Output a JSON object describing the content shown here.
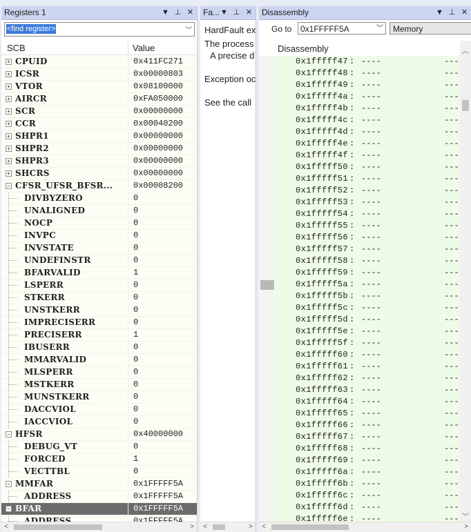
{
  "registers": {
    "title": "Registers 1",
    "find_placeholder": "<find register>",
    "col_name": "SCB",
    "col_value": "Value",
    "rows": [
      {
        "name": "CPUID",
        "value": "0x411FC271",
        "level": 0,
        "expander": "+"
      },
      {
        "name": "ICSR",
        "value": "0x00000803",
        "level": 0,
        "expander": "+"
      },
      {
        "name": "VTOR",
        "value": "0x08100000",
        "level": 0,
        "expander": "+"
      },
      {
        "name": "AIRCR",
        "value": "0xFA050000",
        "level": 0,
        "expander": "+"
      },
      {
        "name": "SCR",
        "value": "0x00000000",
        "level": 0,
        "expander": "+"
      },
      {
        "name": "CCR",
        "value": "0x00040200",
        "level": 0,
        "expander": "+"
      },
      {
        "name": "SHPR1",
        "value": "0x00000000",
        "level": 0,
        "expander": "+"
      },
      {
        "name": "SHPR2",
        "value": "0x00000000",
        "level": 0,
        "expander": "+"
      },
      {
        "name": "SHPR3",
        "value": "0x00000000",
        "level": 0,
        "expander": "+"
      },
      {
        "name": "SHCRS",
        "value": "0x00000000",
        "level": 0,
        "expander": "+"
      },
      {
        "name": "CFSR_UFSR_BFSR...",
        "value": "0x00008200",
        "level": 0,
        "expander": "−"
      },
      {
        "name": "DIVBYZERO",
        "value": "0",
        "level": 1
      },
      {
        "name": "UNALIGNED",
        "value": "0",
        "level": 1
      },
      {
        "name": "NOCP",
        "value": "0",
        "level": 1
      },
      {
        "name": "INVPC",
        "value": "0",
        "level": 1
      },
      {
        "name": "INVSTATE",
        "value": "0",
        "level": 1
      },
      {
        "name": "UNDEFINSTR",
        "value": "0",
        "level": 1
      },
      {
        "name": "BFARVALID",
        "value": "1",
        "level": 1
      },
      {
        "name": "LSPERR",
        "value": "0",
        "level": 1
      },
      {
        "name": "STKERR",
        "value": "0",
        "level": 1
      },
      {
        "name": "UNSTKERR",
        "value": "0",
        "level": 1
      },
      {
        "name": "IMPRECISERR",
        "value": "0",
        "level": 1
      },
      {
        "name": "PRECISERR",
        "value": "1",
        "level": 1
      },
      {
        "name": "IBUSERR",
        "value": "0",
        "level": 1
      },
      {
        "name": "MMARVALID",
        "value": "0",
        "level": 1
      },
      {
        "name": "MLSPERR",
        "value": "0",
        "level": 1
      },
      {
        "name": "MSTKERR",
        "value": "0",
        "level": 1
      },
      {
        "name": "MUNSTKERR",
        "value": "0",
        "level": 1
      },
      {
        "name": "DACCVIOL",
        "value": "0",
        "level": 1
      },
      {
        "name": "IACCVIOL",
        "value": "0",
        "level": 1
      },
      {
        "name": "HFSR",
        "value": "0x40000000",
        "level": 0,
        "expander": "−"
      },
      {
        "name": "DEBUG_VT",
        "value": "0",
        "level": 1
      },
      {
        "name": "FORCED",
        "value": "1",
        "level": 1
      },
      {
        "name": "VECTTBL",
        "value": "0",
        "level": 1
      },
      {
        "name": "MMFAR",
        "value": "0x1FFFFF5A",
        "level": 0,
        "expander": "−"
      },
      {
        "name": "ADDRESS",
        "value": "0x1FFFFF5A",
        "level": 1
      },
      {
        "name": "BFAR",
        "value": "0x1FFFFF5A",
        "level": 0,
        "expander": "−",
        "selected": true
      },
      {
        "name": "ADDRESS",
        "value": "0x1FFFFF5A",
        "level": 1
      }
    ]
  },
  "fault": {
    "title": "Fa...",
    "line1": "HardFault ex",
    "line2": "The process",
    "line3": "A precise d",
    "line4": "Exception oc",
    "line5": "See the call"
  },
  "disassembly": {
    "title": "Disassembly",
    "goto_label": "Go to",
    "goto_value": "0x1FFFFF5A",
    "memory_label": "Memory",
    "column_header": "Disassembly",
    "rows": [
      "0x1fffff47",
      "0x1fffff48",
      "0x1fffff49",
      "0x1fffff4a",
      "0x1fffff4b",
      "0x1fffff4c",
      "0x1fffff4d",
      "0x1fffff4e",
      "0x1fffff4f",
      "0x1fffff50",
      "0x1fffff51",
      "0x1fffff52",
      "0x1fffff53",
      "0x1fffff54",
      "0x1fffff55",
      "0x1fffff56",
      "0x1fffff57",
      "0x1fffff58",
      "0x1fffff59",
      "0x1fffff5a",
      "0x1fffff5b",
      "0x1fffff5c",
      "0x1fffff5d",
      "0x1fffff5e",
      "0x1fffff5f",
      "0x1fffff60",
      "0x1fffff61",
      "0x1fffff62",
      "0x1fffff63",
      "0x1fffff64",
      "0x1fffff65",
      "0x1fffff66",
      "0x1fffff67",
      "0x1fffff68",
      "0x1fffff69",
      "0x1fffff6a",
      "0x1fffff6b",
      "0x1fffff6c",
      "0x1fffff6d",
      "0x1fffff6e"
    ],
    "colon": ":",
    "opcode": "----",
    "mnemonic": "---"
  },
  "icons": {
    "dropdown": "chevron-down-icon",
    "pin": "pin-icon",
    "close": "close-icon"
  }
}
